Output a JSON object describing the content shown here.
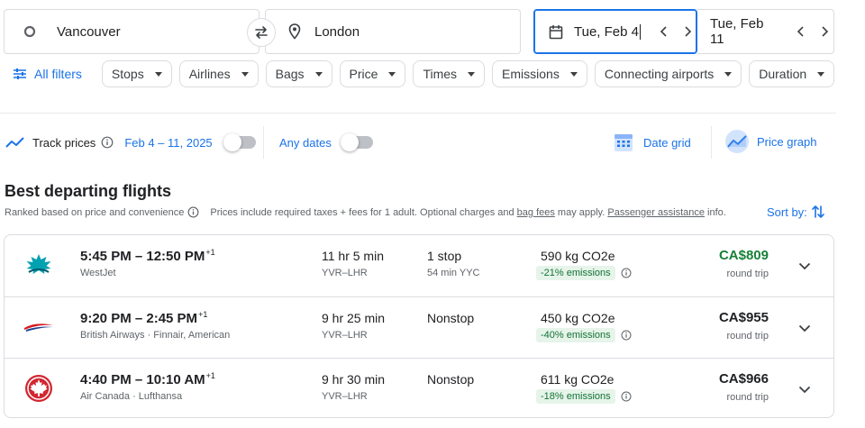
{
  "search": {
    "origin": "Vancouver",
    "destination": "London",
    "depart_date": "Tue, Feb 4",
    "return_date": "Tue, Feb 11"
  },
  "filters": {
    "all_filters": "All filters",
    "chips": [
      "Stops",
      "Airlines",
      "Bags",
      "Price",
      "Times",
      "Emissions",
      "Connecting airports",
      "Duration"
    ]
  },
  "tracking": {
    "label": "Track prices",
    "range": "Feb 4 – 11, 2025",
    "any_dates": "Any dates",
    "date_grid": "Date grid",
    "price_graph": "Price graph"
  },
  "section": {
    "title": "Best departing flights",
    "ranked_note": "Ranked based on price and convenience",
    "prices_note_pre": "Prices include required taxes + fees for 1 adult. Optional charges and ",
    "bag_fees": "bag fees",
    "prices_note_mid": " may apply. ",
    "passenger_assistance": "Passenger assistance",
    "prices_note_post": " info.",
    "sort_by": "Sort by:"
  },
  "flights": [
    {
      "times": "5:45 PM – 12:50 PM",
      "plus_days": "+1",
      "airline": "WestJet",
      "duration": "11 hr 5 min",
      "route": "YVR–LHR",
      "stops": "1 stop",
      "layover": "54 min YYC",
      "co2": "590 kg CO2e",
      "emissions": "-21% emissions",
      "price": "CA$809",
      "trip_type": "round trip",
      "logo_icon": "westjet-logo-icon"
    },
    {
      "times": "9:20 PM – 2:45 PM",
      "plus_days": "+1",
      "airline": "British Airways · Finnair, American",
      "duration": "9 hr 25 min",
      "route": "YVR–LHR",
      "stops": "Nonstop",
      "layover": "",
      "co2": "450 kg CO2e",
      "emissions": "-40% emissions",
      "price": "CA$955",
      "trip_type": "round trip",
      "logo_icon": "british-airways-logo-icon"
    },
    {
      "times": "4:40 PM – 10:10 AM",
      "plus_days": "+1",
      "airline": "Air Canada · Lufthansa",
      "duration": "9 hr 30 min",
      "route": "YVR–LHR",
      "stops": "Nonstop",
      "layover": "",
      "co2": "611 kg CO2e",
      "emissions": "-18% emissions",
      "price": "CA$966",
      "trip_type": "round trip",
      "logo_icon": "air-canada-logo-icon"
    }
  ],
  "colors": {
    "accent": "#1a73e8",
    "deal_price": "#188038",
    "emissions_badge_bg": "#e6f4ea",
    "emissions_badge_text": "#137333",
    "westjet": "#00a1b1",
    "british_airways_red": "#d71920",
    "british_airways_blue": "#1d3f8e",
    "air_canada": "#d22630"
  }
}
